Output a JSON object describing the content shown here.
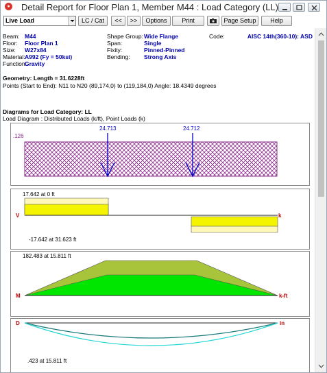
{
  "window": {
    "title": "Detail Report for Floor Plan 1, Member M44 : Load Category (LL)",
    "app_icon": "red-circle-app-icon"
  },
  "toolbar": {
    "category_select": "Live Load",
    "lc_cat": "LC / Cat",
    "prev": "<<",
    "next": ">>",
    "options": "Options",
    "print": "Print",
    "camera_icon": "camera-icon",
    "page_setup": "Page Setup",
    "help": "Help"
  },
  "member": {
    "beam_label": "Beam:",
    "beam": "M44",
    "floor_label": "Floor:",
    "floor": "Floor Plan 1",
    "size_label": "Size:",
    "size": "W27x84",
    "material_label": "Material:",
    "material": "A992 (Fy = 50ksi)",
    "function_label": "Function:",
    "function": "Gravity",
    "shape_group_label": "Shape Group:",
    "shape_group": "Wide Flange",
    "span_label": "Span:",
    "span": "Single",
    "fixity_label": "Fixity:",
    "fixity": "Pinned-Pinned",
    "bending_label": "Bending:",
    "bending": "Strong Axis",
    "code_label": "Code:",
    "code": "AISC 14th(360-10): ASD"
  },
  "geometry": {
    "length": "Geometry: Length = 31.6228ft",
    "points": "Points (Start to End): N11 to N20 (89,174,0) to (119,184,0)   Angle: 18.4349 degrees"
  },
  "diagrams": {
    "heading": "Diagrams for Load Category: LL",
    "subheading": "Load Diagram : Distributed Loads (k/ft), Point Loads (k)",
    "load": {
      "point_load_1": "24.713",
      "point_load_2": "24.712",
      "distributed": ".126"
    },
    "shear": {
      "max_label": "17.642 at 0 ft",
      "min_label": "-17.642 at 31.623 ft",
      "left_tag": "V",
      "right_tag": "k"
    },
    "moment": {
      "max_label": "182.483 at 15.811 ft",
      "left_tag": "M",
      "right_tag": "k-ft"
    },
    "deflection": {
      "max_label": ".423 at 15.811 ft",
      "left_tag": "D",
      "right_tag": "in"
    }
  },
  "colors": {
    "accent_blue": "#0000b0",
    "load_purple": "#8a2a8a",
    "shear_yellow": "#f4f400",
    "moment_green": "#00e600",
    "moment_olive": "#a8c43a",
    "deflection_teal": "#1a7a7a",
    "deflection_cyan": "#22d6d6",
    "tag_red": "#c00000"
  }
}
